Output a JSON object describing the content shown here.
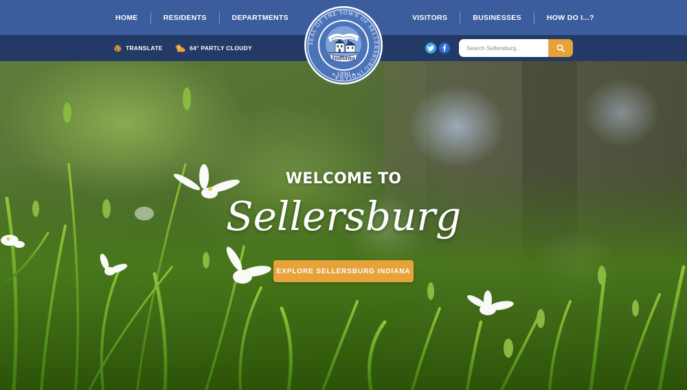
{
  "nav": {
    "left": [
      "HOME",
      "RESIDENTS",
      "DEPARTMENTS"
    ],
    "right": [
      "VISITORS",
      "BUSINESSES",
      "HOW DO I...?"
    ]
  },
  "utility": {
    "translate_label": "TRANSLATE",
    "weather_label": "64° PARTLY CLOUDY",
    "icons": {
      "translate": "globe-icon",
      "weather": "partly-cloudy-icon",
      "twitter": "twitter-icon",
      "facebook": "facebook-icon",
      "search": "search-icon"
    }
  },
  "search": {
    "placeholder": "Search Sellersburg..."
  },
  "seal": {
    "ring_text": "SEAL OF THE TOWN OF SELLERSBURG INDIANA",
    "banner_text": "Indiana",
    "year": "1890"
  },
  "hero": {
    "welcome": "WELCOME TO",
    "town": "Sellersburg",
    "cta_label": "EXPLORE SELLERSBURG INDIANA"
  },
  "colors": {
    "nav_bg": "#3c5d9d",
    "util_bg": "#233a67",
    "accent": "#e8a23a",
    "seal_blue": "#4a73b8"
  }
}
